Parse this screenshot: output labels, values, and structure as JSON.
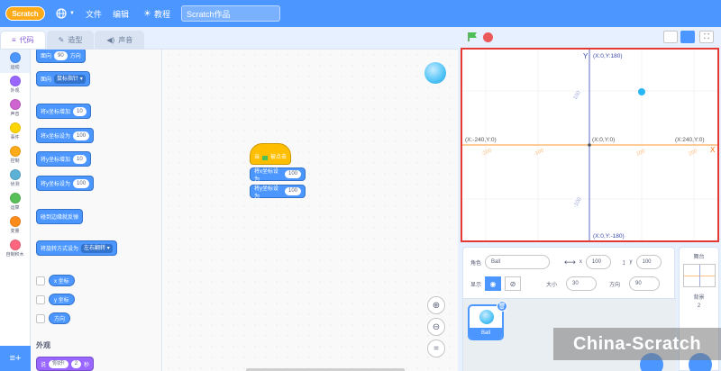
{
  "menubar": {
    "logo": "Scratch",
    "file": "文件",
    "edit": "编辑",
    "tutorials": "教程",
    "project_title": "Scratch作品"
  },
  "tabs": {
    "code": "代码",
    "costumes": "造型",
    "sounds": "声音"
  },
  "categories": [
    {
      "label": "运动",
      "color": "#4c97ff"
    },
    {
      "label": "外观",
      "color": "#9966ff"
    },
    {
      "label": "声音",
      "color": "#cf63cf"
    },
    {
      "label": "事件",
      "color": "#ffd500"
    },
    {
      "label": "控制",
      "color": "#ffab19"
    },
    {
      "label": "侦测",
      "color": "#5cb1d6"
    },
    {
      "label": "运算",
      "color": "#59c059"
    },
    {
      "label": "变量",
      "color": "#ff8c1a"
    },
    {
      "label": "自制积木",
      "color": "#ff6680"
    }
  ],
  "palette": {
    "point_dir_label": "面向",
    "point_dir_val": "90",
    "point_dir_suffix": "方向",
    "point_towards": "面向",
    "point_towards_val": "鼠标指针",
    "change_x": "将x坐标增加",
    "change_x_val": "10",
    "set_x": "将x坐标设为",
    "set_x_val": "100",
    "change_y": "将y坐标增加",
    "change_y_val": "10",
    "set_y": "将y坐标设为",
    "set_y_val": "100",
    "bounce": "碰到边缘就反弹",
    "rotation_style": "将旋转方式设为",
    "rotation_style_val": "左右翻转",
    "x_position": "x 坐标",
    "y_position": "y 坐标",
    "direction": "方向",
    "looks_title": "外观",
    "say_label": "说",
    "say_val": "你好!",
    "say_secs": "2",
    "say_suffix": "秒"
  },
  "script": {
    "hat_label": "当",
    "hat_suffix": "被点击",
    "set_x": "将x坐标设为",
    "set_x_val": "100",
    "set_y": "将y坐标设为",
    "set_y_val": "100"
  },
  "stage": {
    "axis_y_label": "Y",
    "axis_x_label": "X",
    "top": "(X:0,Y:180)",
    "bottom": "(X:0,Y:-180)",
    "left": "(X:-240,Y:0)",
    "right": "(X:240,Y:0)",
    "origin": "(X:0,Y:0)",
    "tick_100": "100",
    "tick_200": "200",
    "tick_n100": "-100",
    "tick_n200": "-200",
    "ytick_100": "100",
    "ytick_n100": "-100"
  },
  "sprite_info": {
    "sprite_label": "角色",
    "sprite_name": "Ball",
    "x_label": "x",
    "x_val": "100",
    "y_label": "y",
    "y_val": "100",
    "show_label": "显示",
    "size_label": "大小",
    "size_val": "30",
    "direction_label": "方向",
    "direction_val": "90",
    "tile_name": "Ball"
  },
  "stage_pane": {
    "title": "舞台",
    "backdrop_label": "背景",
    "backdrop_count": "2"
  },
  "watermark": "China-Scratch",
  "colors": {
    "motion": "#4c97ff",
    "looks": "#9966ff",
    "events": "#ffbf00",
    "menubar": "#4c97ff",
    "highlight": "#e53935"
  }
}
